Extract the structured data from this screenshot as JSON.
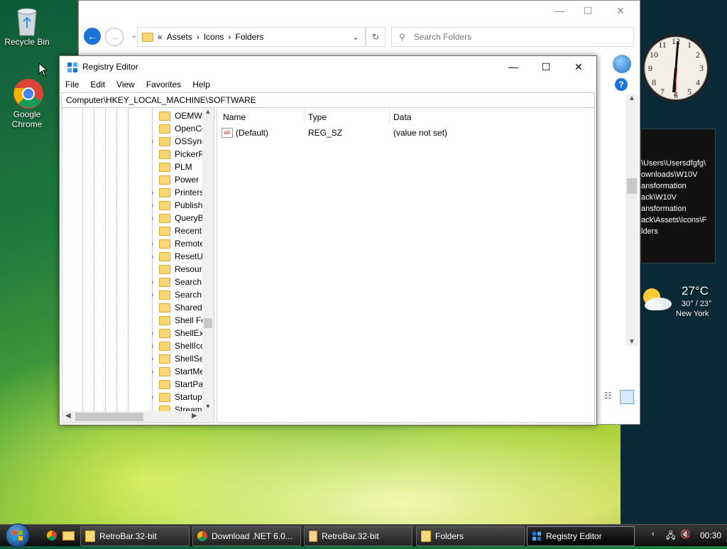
{
  "desktop": {
    "icons": [
      {
        "label": "Recycle Bin"
      },
      {
        "label": "Google Chrome"
      }
    ]
  },
  "explorer": {
    "breadcrumb": [
      "«",
      "Assets",
      "›",
      "Icons",
      "›",
      "Folders"
    ],
    "search_placeholder": "Search Folders"
  },
  "registry": {
    "title": "Registry Editor",
    "menu": [
      "File",
      "Edit",
      "View",
      "Favorites",
      "Help"
    ],
    "path": "Computer\\HKEY_LOCAL_MACHINE\\SOFTWARE",
    "tree_items": [
      {
        "label": "OEMWC",
        "expandable": false
      },
      {
        "label": "OpenCo",
        "expandable": false
      },
      {
        "label": "OSSyncS",
        "expandable": true
      },
      {
        "label": "PickerRe",
        "expandable": false
      },
      {
        "label": "PLM",
        "expandable": false
      },
      {
        "label": "Power",
        "expandable": false
      },
      {
        "label": "PrintersA",
        "expandable": true
      },
      {
        "label": "Publishi",
        "expandable": true
      },
      {
        "label": "QueryBu",
        "expandable": true
      },
      {
        "label": "RecentD",
        "expandable": false
      },
      {
        "label": "Remote",
        "expandable": true
      },
      {
        "label": "ResetUs",
        "expandable": true
      },
      {
        "label": "Resourc",
        "expandable": false
      },
      {
        "label": "Search",
        "expandable": true
      },
      {
        "label": "SearchF",
        "expandable": true
      },
      {
        "label": "SharedU",
        "expandable": false
      },
      {
        "label": "Shell Fol",
        "expandable": false
      },
      {
        "label": "ShellExe",
        "expandable": true
      },
      {
        "label": "ShellIcon",
        "expandable": true
      },
      {
        "label": "ShellSer",
        "expandable": true
      },
      {
        "label": "StartMer",
        "expandable": true
      },
      {
        "label": "StartPag",
        "expandable": false
      },
      {
        "label": "StartupA",
        "expandable": true
      },
      {
        "label": "Streams",
        "expandable": false
      }
    ],
    "columns": {
      "name": "Name",
      "type": "Type",
      "data": "Data"
    },
    "values": [
      {
        "name": "(Default)",
        "type": "REG_SZ",
        "data": "(value not set)"
      }
    ]
  },
  "gadgets": {
    "notes_lines": [
      "\\Users\\Usersdfgfg\\",
      "ownloads\\W10V",
      "ansformation",
      "ack\\W10V",
      "ansformation",
      "ack\\Assets\\Icons\\F",
      "lders"
    ],
    "weather": {
      "temp": "27°C",
      "range": "30° / 23°",
      "city": "New York"
    }
  },
  "taskbar": {
    "tasks": [
      {
        "label": "RetroBar.32-bit",
        "icon": "folder-icon",
        "active": false
      },
      {
        "label": "Download .NET 6.0...",
        "icon": "chrome-icon",
        "active": false
      },
      {
        "label": "RetroBar.32-bit",
        "icon": "archive-icon",
        "active": false
      },
      {
        "label": "Folders",
        "icon": "folder-icon",
        "active": false
      },
      {
        "label": "Registry Editor",
        "icon": "regedit-icon",
        "active": true
      }
    ],
    "clock": "00:30"
  }
}
